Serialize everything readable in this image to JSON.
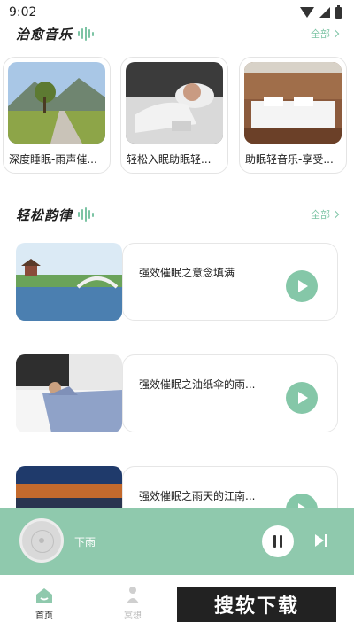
{
  "status_bar": {
    "time": "9:02"
  },
  "sections": {
    "healing": {
      "title": "治愈音乐",
      "see_all": "全部"
    },
    "relax": {
      "title": "轻松韵律",
      "see_all": "全部"
    }
  },
  "healing_cards": [
    {
      "label": "深度睡眠-雨声催..."
    },
    {
      "label": "轻松入眠助眠轻..."
    },
    {
      "label": "助眠轻音乐-享受..."
    }
  ],
  "relax_list": [
    {
      "title": "强效催眠之意念填满"
    },
    {
      "title": "强效催眠之油纸伞的雨..."
    },
    {
      "title": "强效催眠之雨天的江南..."
    }
  ],
  "player": {
    "title": "下雨",
    "accent": "#8fc9ad"
  },
  "bottom_nav": [
    {
      "label": "首页",
      "active": true
    },
    {
      "label": "冥想",
      "active": false
    }
  ],
  "watermark": {
    "text": "搜软下载"
  },
  "colors": {
    "accent": "#7cc4a4",
    "player_bg": "#8fc9ad"
  }
}
